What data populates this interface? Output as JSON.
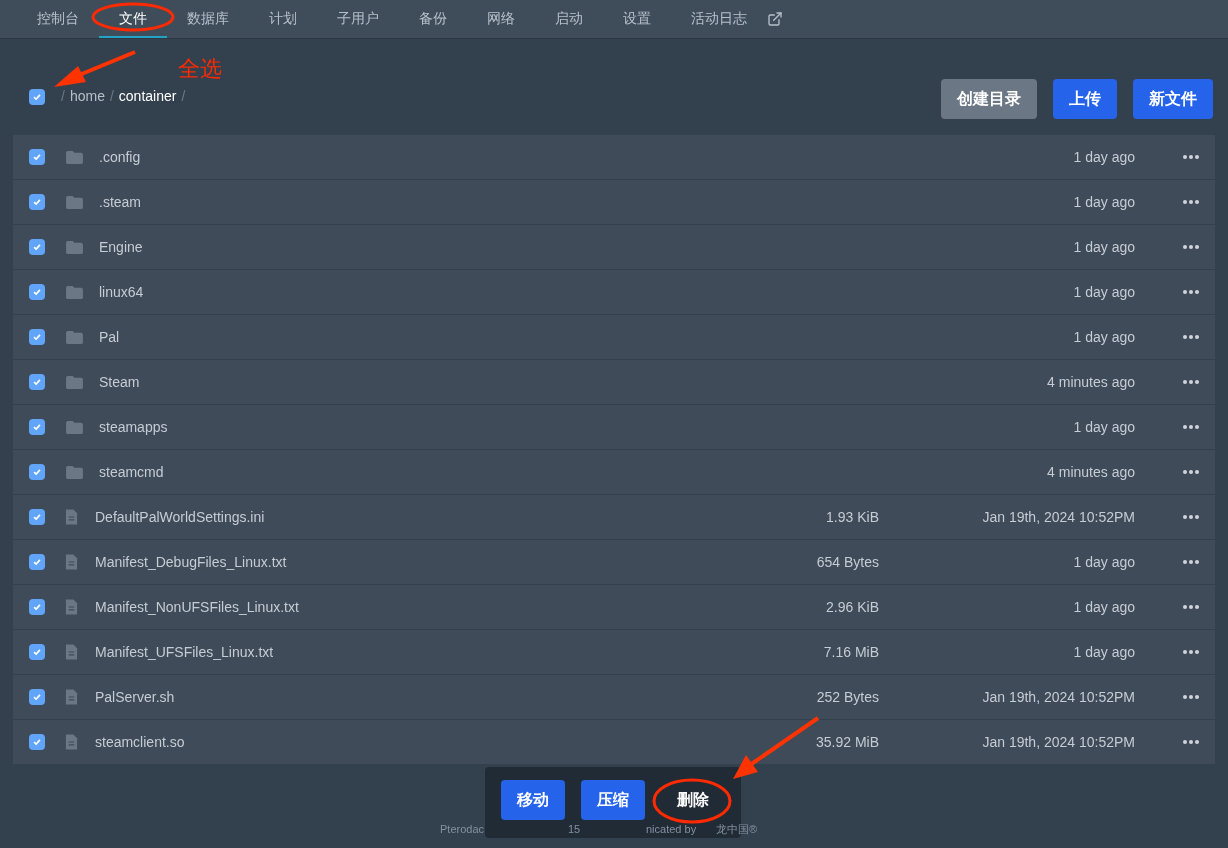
{
  "nav": {
    "tabs": [
      {
        "label": "控制台",
        "selected": false
      },
      {
        "label": "文件",
        "selected": true
      },
      {
        "label": "数据库",
        "selected": false
      },
      {
        "label": "计划",
        "selected": false
      },
      {
        "label": "子用户",
        "selected": false
      },
      {
        "label": "备份",
        "selected": false
      },
      {
        "label": "网络",
        "selected": false
      },
      {
        "label": "启动",
        "selected": false
      },
      {
        "label": "设置",
        "selected": false
      },
      {
        "label": "活动日志",
        "selected": false
      }
    ]
  },
  "select_all": {
    "checked": true
  },
  "breadcrumb": {
    "separator": "/",
    "items": [
      "home",
      "container"
    ]
  },
  "actions": [
    {
      "label": "创建目录",
      "kind": "secondary"
    },
    {
      "label": "上传",
      "kind": "primary"
    },
    {
      "label": "新文件",
      "kind": "primary"
    }
  ],
  "files": [
    {
      "kind": "folder",
      "name": ".config",
      "date": "1 day ago",
      "checked": true
    },
    {
      "kind": "folder",
      "name": ".steam",
      "date": "1 day ago",
      "checked": true
    },
    {
      "kind": "folder",
      "name": "Engine",
      "date": "1 day ago",
      "checked": true
    },
    {
      "kind": "folder",
      "name": "linux64",
      "date": "1 day ago",
      "checked": true
    },
    {
      "kind": "folder",
      "name": "Pal",
      "date": "1 day ago",
      "checked": true
    },
    {
      "kind": "folder",
      "name": "Steam",
      "date": "4 minutes ago",
      "checked": true
    },
    {
      "kind": "folder",
      "name": "steamapps",
      "date": "1 day ago",
      "checked": true
    },
    {
      "kind": "folder",
      "name": "steamcmd",
      "date": "4 minutes ago",
      "checked": true
    },
    {
      "kind": "file",
      "name": "DefaultPalWorldSettings.ini",
      "size": "1.93 KiB",
      "date": "Jan 19th, 2024 10:52PM",
      "checked": true
    },
    {
      "kind": "file",
      "name": "Manifest_DebugFiles_Linux.txt",
      "size": "654 Bytes",
      "date": "1 day ago",
      "checked": true
    },
    {
      "kind": "file",
      "name": "Manifest_NonUFSFiles_Linux.txt",
      "size": "2.96 KiB",
      "date": "1 day ago",
      "checked": true
    },
    {
      "kind": "file",
      "name": "Manifest_UFSFiles_Linux.txt",
      "size": "7.16 MiB",
      "date": "1 day ago",
      "checked": true
    },
    {
      "kind": "file",
      "name": "PalServer.sh",
      "size": "252 Bytes",
      "date": "Jan 19th, 2024 10:52PM",
      "checked": true
    },
    {
      "kind": "file",
      "name": "steamclient.so",
      "size": "35.92 MiB",
      "date": "Jan 19th, 2024 10:52PM",
      "checked": true
    }
  ],
  "footer_fragments": [
    "Pterodac",
    "15",
    "nicated by",
    "龙中国®"
  ],
  "bulk_actions": [
    {
      "label": "移动",
      "kind": "primary"
    },
    {
      "label": "压缩",
      "kind": "primary"
    },
    {
      "label": "删除",
      "kind": "plain"
    }
  ],
  "annotation": {
    "label": "全选"
  }
}
